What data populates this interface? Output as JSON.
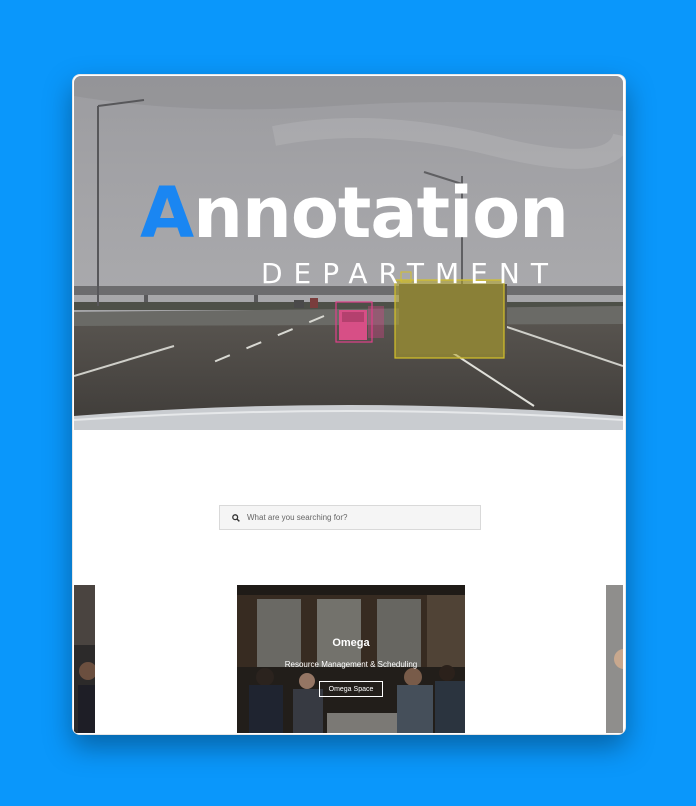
{
  "hero": {
    "title_accent": "A",
    "title_rest": "nnotation",
    "subtitle": "DEPARTMENT"
  },
  "search": {
    "placeholder": "What are you searching for?",
    "icon": "search-icon"
  },
  "card": {
    "title": "Omega",
    "subtitle": "Resource Management & Scheduling",
    "button_label": "Omega Space"
  },
  "colors": {
    "page_background": "#0a97fb",
    "accent": "#1a86f2",
    "bbox_yellow": "#d4c12a",
    "bbox_pink": "#e0408a"
  }
}
